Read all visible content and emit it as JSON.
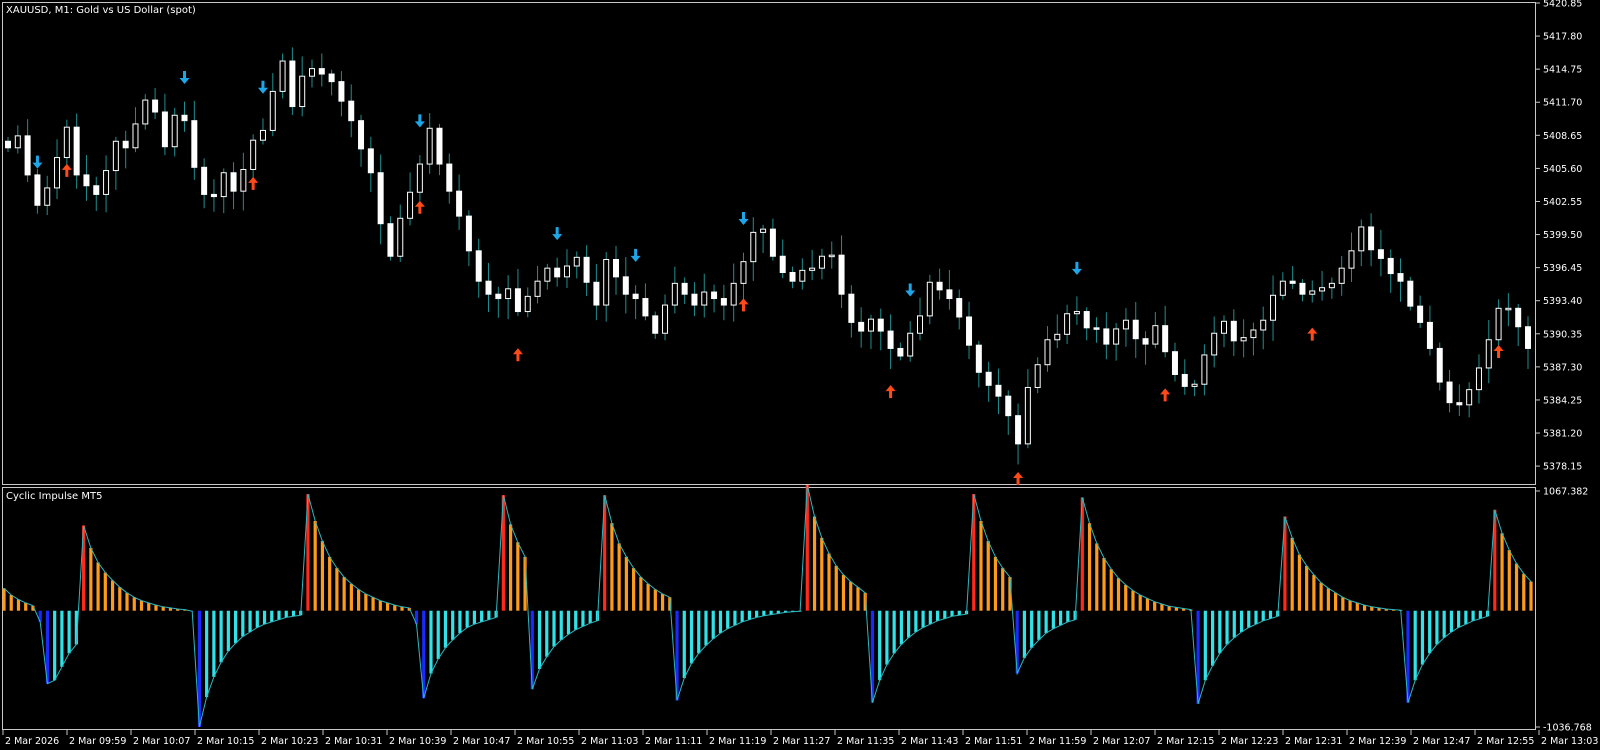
{
  "main_title": "XAUUSD, M1:  Gold vs US Dollar (spot)",
  "indicator_title": "Cyclic Impulse MT5",
  "colors": {
    "background": "#000000",
    "frame": "#c8c8c8",
    "candle_up": "#ffffff",
    "candle_down": "#ffffff",
    "wick": "#1f8f8f",
    "arrow_down": "#1ea7e8",
    "arrow_up": "#ff4a1a",
    "hist_pos": "#ff9a1a",
    "hist_pos_peak": "#ff2a1a",
    "hist_neg": "#2fe3e8",
    "hist_neg_peak": "#1a2aff",
    "hist_outline": "#2fb8c0"
  },
  "price_axis_labels": [
    "5420.85",
    "5417.80",
    "5414.75",
    "5411.70",
    "5408.65",
    "5405.60",
    "5402.55",
    "5399.50",
    "5396.45",
    "5393.40",
    "5390.35",
    "5387.30",
    "5384.25",
    "5381.20",
    "5378.15"
  ],
  "indicator_axis_labels": [
    "1067.382",
    "-1036.768"
  ],
  "time_labels": [
    "2 Mar 2026",
    "2 Mar 09:59",
    "2 Mar 10:07",
    "2 Mar 10:15",
    "2 Mar 10:23",
    "2 Mar 10:31",
    "2 Mar 10:39",
    "2 Mar 10:47",
    "2 Mar 10:55",
    "2 Mar 11:03",
    "2 Mar 11:11",
    "2 Mar 11:19",
    "2 Mar 11:27",
    "2 Mar 11:35",
    "2 Mar 11:43",
    "2 Mar 11:51",
    "2 Mar 11:59",
    "2 Mar 12:07",
    "2 Mar 12:15",
    "2 Mar 12:23",
    "2 Mar 12:31",
    "2 Mar 12:39",
    "2 Mar 12:47",
    "2 Mar 12:55",
    "2 Mar 13:03"
  ],
  "chart_data": [
    {
      "type": "candlestick",
      "title": "XAUUSD, M1:  Gold vs US Dollar (spot)",
      "ylim": [
        5376.5,
        5420.85
      ],
      "grid": false,
      "close_series": [
        5407.5,
        5408.6,
        5405.0,
        5402.2,
        5403.8,
        5406.6,
        5409.4,
        5405.0,
        5404.0,
        5403.2,
        5405.4,
        5408.1,
        5407.5,
        5409.7,
        5411.9,
        5410.8,
        5407.6,
        5410.5,
        5410.0,
        5405.7,
        5403.2,
        5403.0,
        5405.2,
        5403.5,
        5405.5,
        5408.2,
        5409.1,
        5412.7,
        5415.5,
        5411.3,
        5414.1,
        5414.8,
        5414.3,
        5413.6,
        5411.8,
        5410.0,
        5407.4,
        5405.2,
        5400.5,
        5397.5,
        5401.0,
        5403.4,
        5406.0,
        5409.3,
        5406.0,
        5403.5,
        5401.2,
        5398.0,
        5395.2,
        5394.0,
        5393.6,
        5394.5,
        5392.4,
        5393.8,
        5395.2,
        5396.4,
        5395.6,
        5396.6,
        5397.4,
        5395.1,
        5393.0,
        5397.2,
        5395.6,
        5394.0,
        5393.6,
        5392.0,
        5390.4,
        5393.0,
        5395.0,
        5394.0,
        5393.0,
        5394.2,
        5393.6,
        5393.0,
        5395.0,
        5397.0,
        5399.7,
        5400.0,
        5397.5,
        5396.0,
        5395.2,
        5396.2,
        5396.4,
        5397.5,
        5397.6,
        5394.0,
        5391.4,
        5390.6,
        5391.7,
        5390.6,
        5389.0,
        5388.3,
        5390.4,
        5392.0,
        5395.1,
        5394.4,
        5393.6,
        5391.9,
        5389.3,
        5386.8,
        5385.6,
        5384.6,
        5382.8,
        5380.2,
        5385.4,
        5387.5,
        5389.8,
        5390.3,
        5392.2,
        5392.4,
        5390.9,
        5390.8,
        5389.4,
        5390.8,
        5391.6,
        5389.9,
        5389.4,
        5391.1,
        5388.7,
        5386.6,
        5385.5,
        5385.7,
        5388.4,
        5390.4,
        5391.5,
        5389.7,
        5390.0,
        5390.7,
        5391.6,
        5393.9,
        5395.2,
        5395.0,
        5394.0,
        5394.3,
        5394.6,
        5395.0,
        5396.4,
        5398.0,
        5400.2,
        5398.1,
        5397.3,
        5395.9,
        5395.2,
        5392.9,
        5391.4,
        5389.0,
        5385.9,
        5384.0,
        5383.8,
        5385.2,
        5387.2,
        5389.8,
        5392.7,
        5392.7,
        5391.0,
        5389.0
      ],
      "annotations": {
        "sell_arrows_count": 9,
        "buy_arrows_count": 10
      }
    },
    {
      "type": "bar",
      "title": "Cyclic Impulse MT5",
      "ylim": [
        -1036.768,
        1067.382
      ],
      "series": [
        {
          "values": [
            200,
            140,
            100,
            70,
            45,
            -100,
            -650,
            -620,
            -500,
            -380,
            -300,
            760,
            560,
            430,
            340,
            270,
            210,
            160,
            120,
            90,
            70,
            50,
            35,
            25,
            15,
            10,
            -5,
            -1036,
            -770,
            -590,
            -460,
            -360,
            -290,
            -230,
            -190,
            -150,
            -120,
            -100,
            -80,
            -60,
            -50,
            -40,
            1040,
            800,
            620,
            480,
            380,
            300,
            240,
            190,
            150,
            120,
            90,
            70,
            50,
            35,
            25,
            -120,
            -780,
            -560,
            -430,
            -330,
            -260,
            -200,
            -150,
            -120,
            -100,
            -80,
            -60,
            1030,
            770,
            610,
            480,
            -700,
            -520,
            -410,
            -320,
            -260,
            -210,
            -170,
            -140,
            -110,
            -90,
            1030,
            780,
            600,
            480,
            380,
            300,
            240,
            190,
            150,
            120,
            -800,
            -600,
            -470,
            -380,
            -310,
            -250,
            -200,
            -160,
            -130,
            -100,
            -80,
            -60,
            -45,
            -35,
            -25,
            -15,
            -10,
            -5,
            1120,
            840,
            650,
            510,
            400,
            320,
            260,
            210,
            160,
            -820,
            -620,
            -480,
            -380,
            -300,
            -240,
            -190,
            -150,
            -120,
            -90,
            -70,
            -50,
            -40,
            -30,
            1040,
            800,
            620,
            480,
            380,
            300,
            -560,
            -420,
            -330,
            -260,
            -200,
            -160,
            -130,
            -100,
            -80,
            1010,
            780,
            600,
            470,
            370,
            290,
            230,
            180,
            140,
            110,
            80,
            60,
            40,
            30,
            20,
            10,
            -830,
            -620,
            -490,
            -380,
            -300,
            -240,
            -190,
            -150,
            -120,
            -90,
            -70,
            -50,
            840,
            650,
            500,
            400,
            320,
            250,
            200,
            160,
            120,
            90,
            70,
            50,
            35,
            25,
            15,
            10,
            5,
            -820,
            -620,
            -480,
            -380,
            -300,
            -240,
            -190,
            -150,
            -120,
            -90,
            -70,
            -50,
            900,
            690,
            540,
            420,
            330,
            260
          ]
        }
      ]
    }
  ]
}
